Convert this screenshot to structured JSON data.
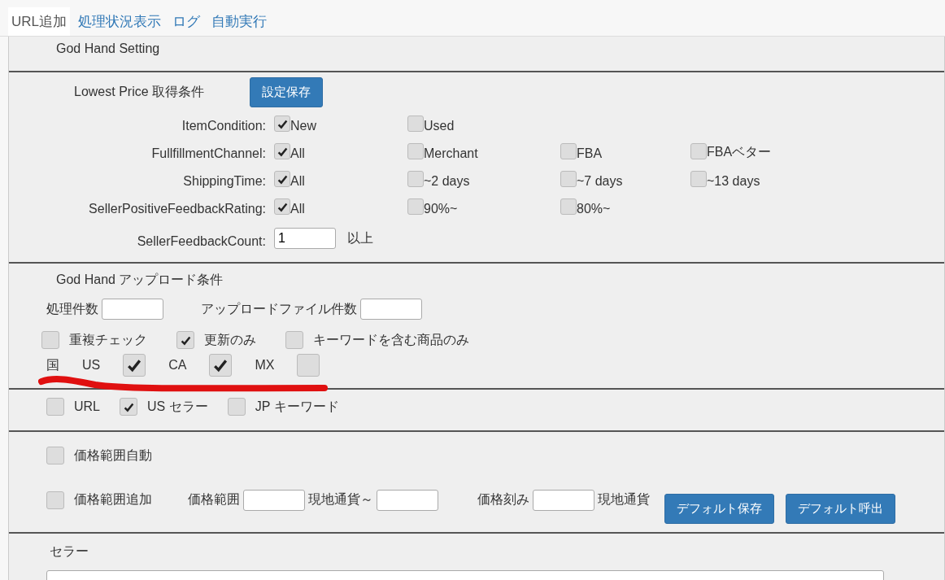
{
  "tabs": [
    {
      "label": "URL追加",
      "selected": true
    },
    {
      "label": "処理状況表示",
      "selected": false
    },
    {
      "label": "ログ",
      "selected": false
    },
    {
      "label": "自動実行",
      "selected": false
    }
  ],
  "god_hand_setting": {
    "title": "God Hand Setting"
  },
  "lowest_price": {
    "title": "Lowest Price 取得条件",
    "save_button": "設定保存",
    "rows": [
      {
        "label": "ItemCondition:",
        "options": [
          {
            "label": "New",
            "checked": true
          },
          {
            "label": "Used",
            "checked": false
          }
        ]
      },
      {
        "label": "FullfillmentChannel:",
        "options": [
          {
            "label": "All",
            "checked": true
          },
          {
            "label": "Merchant",
            "checked": false
          },
          {
            "label": "FBA",
            "checked": false
          },
          {
            "label": "FBAベター",
            "checked": false
          }
        ]
      },
      {
        "label": "ShippingTime:",
        "options": [
          {
            "label": "All",
            "checked": true
          },
          {
            "label": "~2 days",
            "checked": false
          },
          {
            "label": "~7 days",
            "checked": false
          },
          {
            "label": "~13 days",
            "checked": false
          }
        ]
      },
      {
        "label": "SellerPositiveFeedbackRating:",
        "options": [
          {
            "label": "All",
            "checked": true
          },
          {
            "label": "90%~",
            "checked": false
          },
          {
            "label": "80%~",
            "checked": false
          }
        ]
      }
    ],
    "feedback_count": {
      "label": "SellerFeedbackCount:",
      "value": "1",
      "suffix": "以上"
    }
  },
  "upload": {
    "title": "God Hand アップロード条件",
    "fields": [
      {
        "label": "処理件数"
      },
      {
        "label": "アップロードファイル件数"
      }
    ],
    "checks": [
      {
        "label": "重複チェック",
        "checked": false
      },
      {
        "label": "更新のみ",
        "checked": true
      },
      {
        "label": "キーワードを含む商品のみ",
        "checked": false
      }
    ],
    "country": {
      "label": "国",
      "options": [
        {
          "label": "US",
          "checked": true
        },
        {
          "label": "CA",
          "checked": true
        },
        {
          "label": "MX",
          "checked": false
        }
      ]
    }
  },
  "source": {
    "checks": [
      {
        "label": "URL",
        "checked": false
      },
      {
        "label": "US セラー",
        "checked": true
      },
      {
        "label": "JP キーワード",
        "checked": false
      }
    ]
  },
  "price": {
    "auto": {
      "label": "価格範囲自動",
      "checked": false
    },
    "add": {
      "label": "価格範囲追加",
      "checked": false
    },
    "range_label": "価格範囲",
    "range_mid": "現地通貨～",
    "step_label": "価格刻み",
    "unit": "現地通貨",
    "buttons": [
      "デフォルト保存",
      "デフォルト呼出"
    ]
  },
  "seller": {
    "title": "セラー"
  }
}
